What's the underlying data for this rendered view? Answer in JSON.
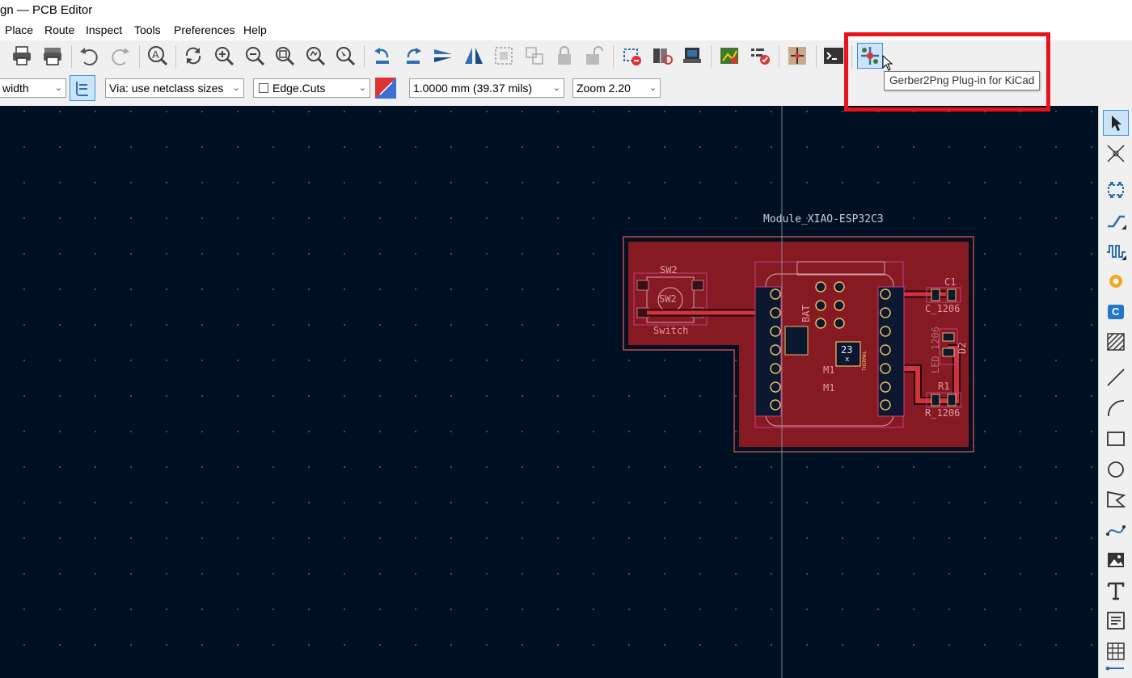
{
  "window": {
    "title": "gn — PCB Editor"
  },
  "menu": [
    "Place",
    "Route",
    "Inspect",
    "Tools",
    "Preferences",
    "Help"
  ],
  "toolbar": {
    "track_width": "width",
    "via_size": "Via: use netclass sizes",
    "layer": "Edge.Cuts",
    "grid": "1.0000 mm (39.37 mils)",
    "zoom": "Zoom 2.20"
  },
  "tooltip": {
    "text": "Gerber2Png Plug-in for KiCad"
  },
  "board": {
    "module_label": "Module_XIAO-ESP32C3",
    "sw_ref_top": "SW2",
    "sw_ref_center": "SW2",
    "sw_value": "Switch",
    "bat_label": "BAT",
    "m1_ref": "M1",
    "m1_value": "M1",
    "thermal_num": "23",
    "thermal_x": "x",
    "thermal_text": "THERMAL",
    "c1_ref": "C1",
    "c1_value": "C_1206",
    "d2_ref": "D2",
    "led_value": "LED_1206",
    "r1_ref": "R1",
    "r1_value": "R_1206"
  },
  "colors": {
    "canvas_bg": "#001023",
    "board_fill": "#861a22",
    "track": "#d6303a",
    "courtyard": "#c83c8c",
    "highlight": "#e8141b"
  }
}
